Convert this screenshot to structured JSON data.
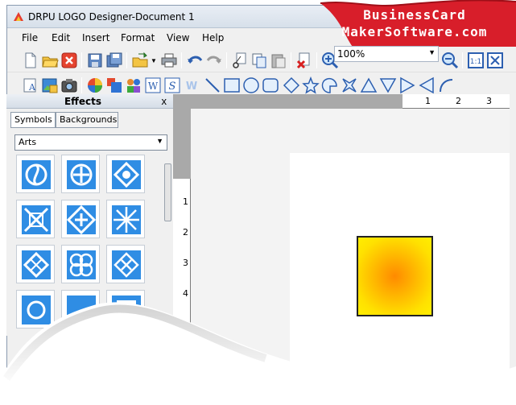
{
  "window": {
    "title": "DRPU LOGO Designer-Document 1"
  },
  "brand": {
    "line1": "BusinessCard",
    "line2": "MakerSoftware.com"
  },
  "menu": {
    "items": [
      "File",
      "Edit",
      "Insert",
      "Format",
      "View",
      "Help"
    ]
  },
  "zoom": {
    "value": "100%"
  },
  "effects": {
    "title": "Effects",
    "close": "x",
    "tabs": [
      "Symbols",
      "Backgrounds"
    ],
    "category": "Arts"
  },
  "rulers": {
    "horizontal": [
      "1",
      "2",
      "3"
    ],
    "vertical": [
      "1",
      "2",
      "3",
      "4"
    ]
  },
  "colors": {
    "brand_red": "#d81e2a",
    "accent_blue": "#2f8de4",
    "logo_center": "#ff8a00",
    "logo_edge": "#ffee00"
  }
}
